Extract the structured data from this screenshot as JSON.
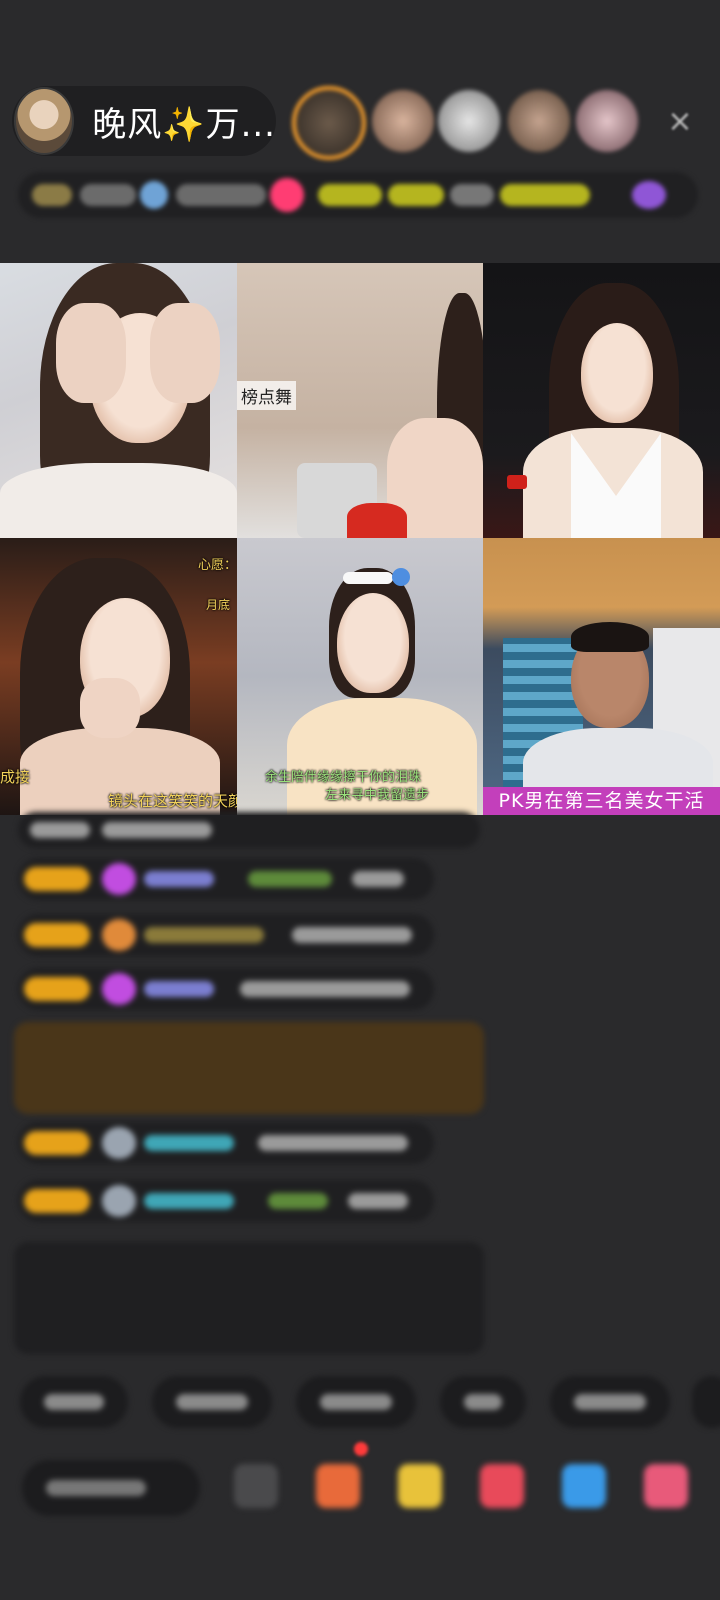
{
  "header": {
    "host_name": "晚风✨万...",
    "close_icon": "×"
  },
  "grid": {
    "tile2_caption": "榜点舞",
    "tile4_overlay_top": "心愿：",
    "tile4_overlay_mid": "月底",
    "tile4_overlay_left": "成接",
    "tile4_overlay_bottom": "镜头在这笑笑的天颜",
    "tile5_overlay_1": "余生陪伴缘缘擦干你的泪珠",
    "tile5_overlay_2": "左来寻中我留遗步",
    "pk_banner": "PK男在第三名美女干活"
  },
  "colors": {
    "background": "#2a2a2c",
    "accent_gold": "#e6a21a",
    "pk_magenta": "#c33fbb"
  }
}
